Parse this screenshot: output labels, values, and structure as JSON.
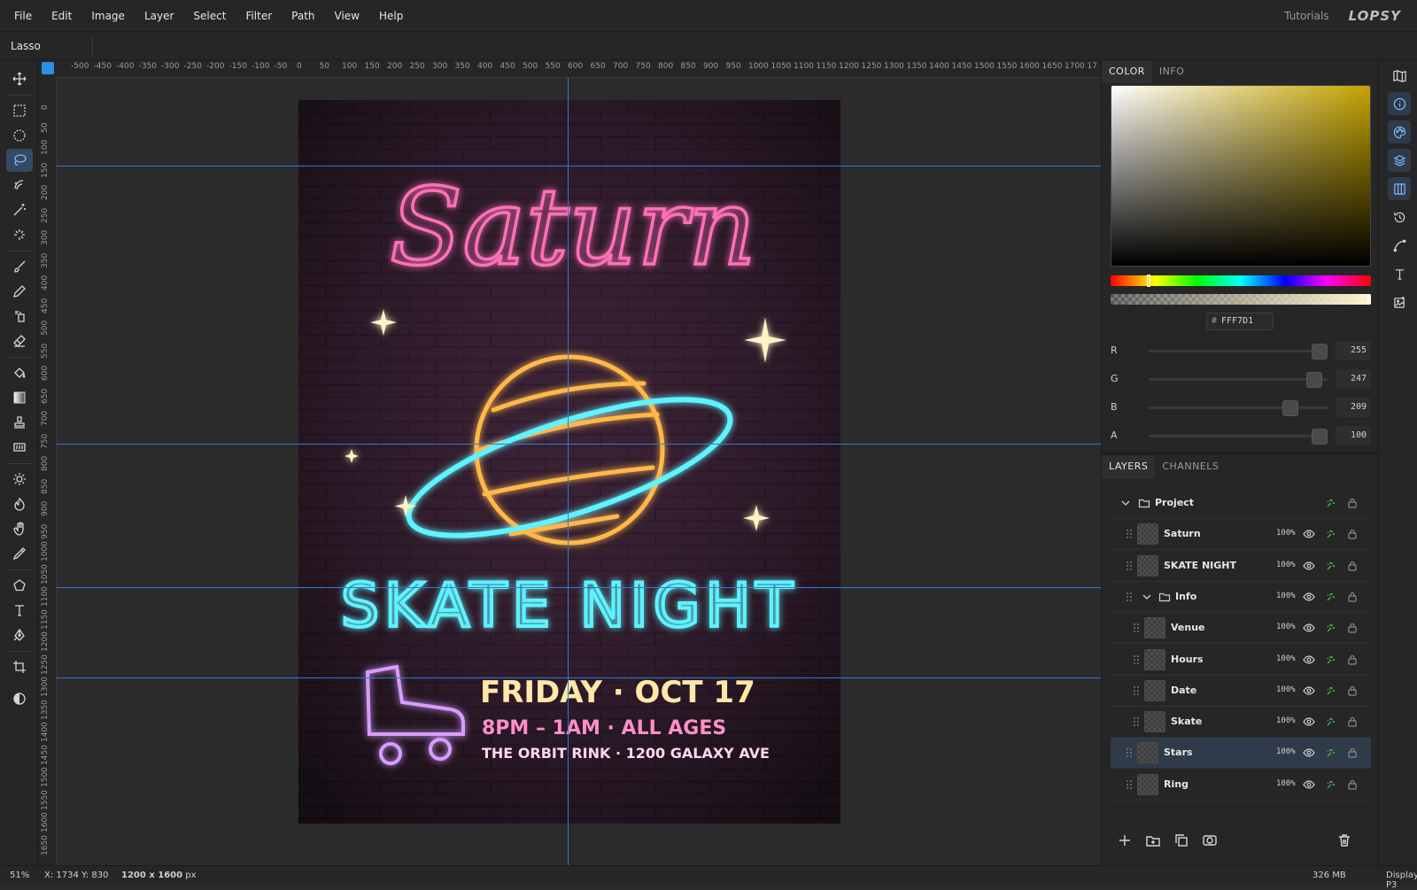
{
  "menu": [
    "File",
    "Edit",
    "Image",
    "Layer",
    "Select",
    "Filter",
    "Path",
    "View",
    "Help"
  ],
  "header": {
    "tutorials": "Tutorials",
    "logo": "LOPSY"
  },
  "options": {
    "tool_name": "Lasso"
  },
  "tools": [
    {
      "name": "move-tool",
      "icon": "move-icon"
    },
    {
      "name": "rect-select-tool",
      "icon": "rect-select-icon"
    },
    {
      "name": "ellipse-select-tool",
      "icon": "ellipse-select-icon"
    },
    {
      "name": "lasso-tool",
      "icon": "lasso-icon",
      "active": true
    },
    {
      "name": "quick-select-tool",
      "icon": "quick-select-icon"
    },
    {
      "name": "magic-wand-tool",
      "icon": "magic-wand-icon"
    },
    {
      "name": "spot-heal-tool",
      "icon": "spot-heal-icon"
    },
    {
      "name": "brush-tool",
      "icon": "brush-icon"
    },
    {
      "name": "pencil-tool",
      "icon": "pencil-icon"
    },
    {
      "name": "clone-tool",
      "icon": "clone-icon"
    },
    {
      "name": "eraser-tool",
      "icon": "eraser-icon"
    },
    {
      "name": "fill-tool",
      "icon": "paint-bucket-icon"
    },
    {
      "name": "gradient-tool",
      "icon": "gradient-icon"
    },
    {
      "name": "stamp-tool",
      "icon": "stamp-icon"
    },
    {
      "name": "pattern-tool",
      "icon": "pattern-icon"
    },
    {
      "name": "dodge-tool",
      "icon": "dodge-icon"
    },
    {
      "name": "burn-tool",
      "icon": "burn-icon"
    },
    {
      "name": "smudge-tool",
      "icon": "smudge-icon"
    },
    {
      "name": "color-picker-tool",
      "icon": "eyedropper-icon"
    },
    {
      "name": "shape-tool",
      "icon": "pentagon-icon"
    },
    {
      "name": "text-tool",
      "icon": "text-icon"
    },
    {
      "name": "pen-tool",
      "icon": "pen-icon"
    },
    {
      "name": "crop-tool",
      "icon": "crop-icon"
    },
    {
      "name": "color-mode-tool",
      "icon": "contrast-icon"
    }
  ],
  "rulers": {
    "h_ticks": [
      "-500",
      "-450",
      "-400",
      "-350",
      "-300",
      "-250",
      "-200",
      "-150",
      "-100",
      "-50",
      "0",
      "50",
      "100",
      "150",
      "200",
      "250",
      "300",
      "350",
      "400",
      "450",
      "500",
      "550",
      "600",
      "650",
      "700",
      "750",
      "800",
      "850",
      "900",
      "950",
      "1000",
      "1050",
      "1100",
      "1150",
      "1200",
      "1250",
      "1300",
      "1350",
      "1400",
      "1450",
      "1500",
      "1550",
      "1600",
      "1650",
      "1700",
      "17"
    ],
    "v_ticks": [
      "0",
      "50",
      "100",
      "150",
      "200",
      "250",
      "300",
      "350",
      "400",
      "450",
      "500",
      "550",
      "600",
      "650",
      "700",
      "750",
      "800",
      "850",
      "900",
      "950",
      "1000",
      "1050",
      "1100",
      "1150",
      "1200",
      "1250",
      "1300",
      "1350",
      "1400",
      "1450",
      "1500",
      "1550",
      "1600",
      "1650"
    ]
  },
  "poster": {
    "title": "Saturn",
    "headline": "SKATE NIGHT",
    "date_line": "FRIDAY · OCT 17",
    "hours_line": "8PM – 1AM · ALL AGES",
    "venue_line": "THE ORBIT RINK · 1200 GALAXY AVE"
  },
  "colors": {
    "pink_neon": "#ff6fb8",
    "cyan_neon": "#5ef2ff",
    "orange_neon": "#ffb84a",
    "yellow_text": "#ffe7a8",
    "violet_neon": "#d89cff",
    "guide_blue": "#2f7bd2",
    "accent": "#2b8fe8",
    "layer_green": "#4caf50"
  },
  "color_panel": {
    "tabs": [
      "COLOR",
      "INFO"
    ],
    "active_tab": "COLOR",
    "hex": "FFF7D1",
    "hue_position": 0.14,
    "channels": [
      {
        "label": "R",
        "value": "255",
        "level": 1.0
      },
      {
        "label": "G",
        "value": "247",
        "level": 0.97
      },
      {
        "label": "B",
        "value": "209",
        "level": 0.82
      },
      {
        "label": "A",
        "value": "100",
        "level": 1.0
      }
    ]
  },
  "layers_panel": {
    "tabs": [
      "LAYERS",
      "CHANNELS"
    ],
    "active_tab": "LAYERS",
    "items": [
      {
        "name": "Project",
        "type": "group-root",
        "opacity": ""
      },
      {
        "name": "Saturn",
        "type": "layer",
        "opacity": "100%"
      },
      {
        "name": "SKATE NIGHT",
        "type": "layer",
        "opacity": "100%"
      },
      {
        "name": "Info",
        "type": "group",
        "opacity": "100%"
      },
      {
        "name": "Venue",
        "type": "child",
        "opacity": "100%"
      },
      {
        "name": "Hours",
        "type": "child",
        "opacity": "100%"
      },
      {
        "name": "Date",
        "type": "child",
        "opacity": "100%"
      },
      {
        "name": "Skate",
        "type": "child",
        "opacity": "100%"
      },
      {
        "name": "Stars",
        "type": "layer",
        "opacity": "100%",
        "selected": true
      },
      {
        "name": "Ring",
        "type": "layer",
        "opacity": "100%"
      }
    ]
  },
  "status": {
    "zoom": "51%",
    "coords": "X: 1734  Y: 830",
    "doc_size": "1200 x 1600",
    "doc_unit": "px",
    "memory": "326 MB",
    "display": "Display P3"
  }
}
